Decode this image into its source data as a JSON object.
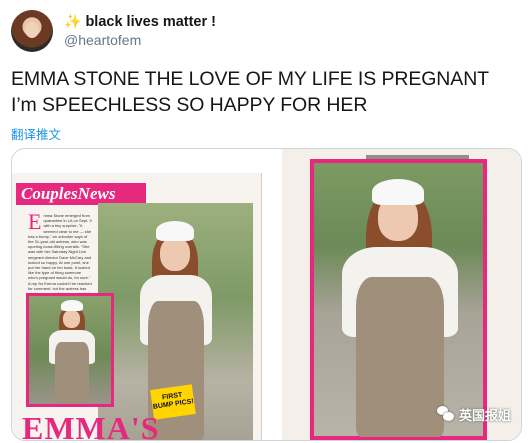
{
  "tweet": {
    "display_name": "black lives matter !",
    "name_emoji": "✨",
    "handle": "@heartofem",
    "text_lines": [
      "EMMA STONE THE LOVE OF MY LIFE IS PREGNANT",
      "I’m SPEECHLESS SO HAPPY FOR HER"
    ],
    "translate_label": "翻译推文"
  },
  "media": {
    "magazine_section": "CouplesNews",
    "badge": "FIRST BUMP PICS!",
    "headline_partial": "EMMA'S",
    "article_text": "mma Stone emerged from quarantine in LA on Sept. 9 with a tiny surprise. \"It seemed clear to me — she has a bump,\" an onlooker says of the 31-year-old actress, who was sporting loose-fitting overalls. \"She was with her Saturday Night Live sergeant director Dave McCary and looked so happy. At one point, she put her hand on her back. It looked like the type of thing someone who's pregnant would do, for sure.\" A rep for Emma couldn't be reached for comment, but the actress has made no secret that she wants kids. \"At one point I was talking to about kids with her. I've gotten older,\" she said in 2016. She started dating Dave in 2017 and they got engaged in December 2019. \"I never expected it to happen... I'm not getting married, I'm never having kids. I really want to have kids!\" Apparently she got her wish — in both. In the photos, Emma and Dave postponed their wedding in the spring because of COVID-19 are also wearing matching bands on their ring fingers!",
    "watermark": "英国报姐"
  }
}
